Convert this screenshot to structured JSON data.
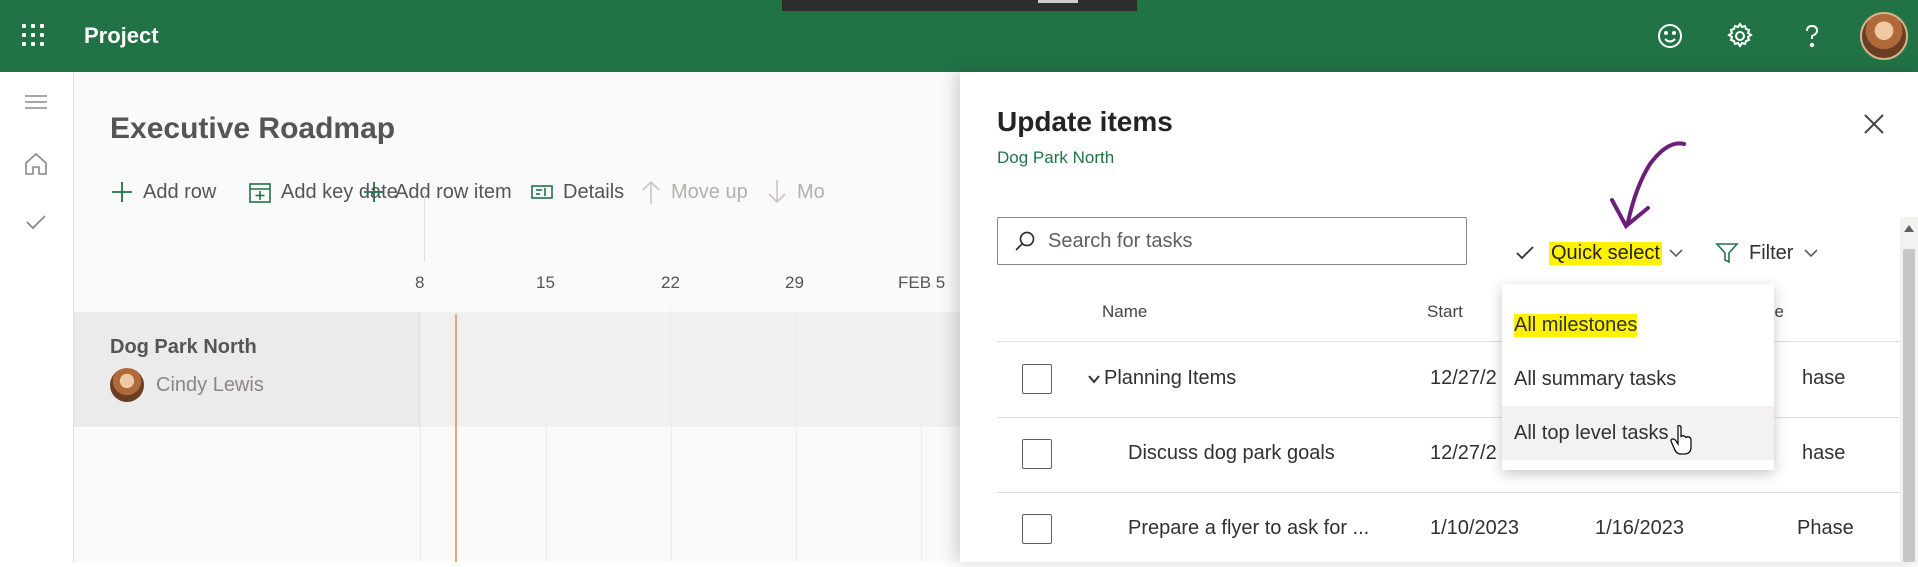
{
  "app": {
    "title": "Project"
  },
  "page": {
    "title": "Executive Roadmap"
  },
  "commands": [
    {
      "label": "Add row"
    },
    {
      "label": "Add key date"
    },
    {
      "label": "Add row item"
    },
    {
      "label": "Details"
    },
    {
      "label": "Move up"
    },
    {
      "label": "Mo"
    }
  ],
  "timeline": {
    "headers": [
      "8",
      "15",
      "22",
      "29",
      "FEB 5"
    ]
  },
  "roadmap_row": {
    "name": "Dog Park North",
    "owner": "Cindy Lewis"
  },
  "panel": {
    "title": "Update items",
    "subtitle": "Dog Park North",
    "search_placeholder": "Search for tasks",
    "quick_select_label": "Quick select",
    "filter_label": "Filter",
    "columns": {
      "name": "Name",
      "start": "Start",
      "type_partial": "pe"
    },
    "rows": [
      {
        "name": "Planning Items",
        "start": "12/27/2",
        "finish": "",
        "type": "hase"
      },
      {
        "name": "Discuss dog park goals",
        "start": "12/27/2",
        "finish": "",
        "type": "hase"
      },
      {
        "name": "Prepare a flyer to ask for ...",
        "start": "1/10/2023",
        "finish": "1/16/2023",
        "type": "Phase"
      }
    ]
  },
  "quick_select_menu": {
    "items": [
      {
        "label": "All milestones"
      },
      {
        "label": "All summary tasks"
      },
      {
        "label": "All top level tasks"
      }
    ]
  },
  "colors": {
    "brand": "#217346",
    "highlight": "#fff200",
    "annotation": "#6b1f7a"
  }
}
